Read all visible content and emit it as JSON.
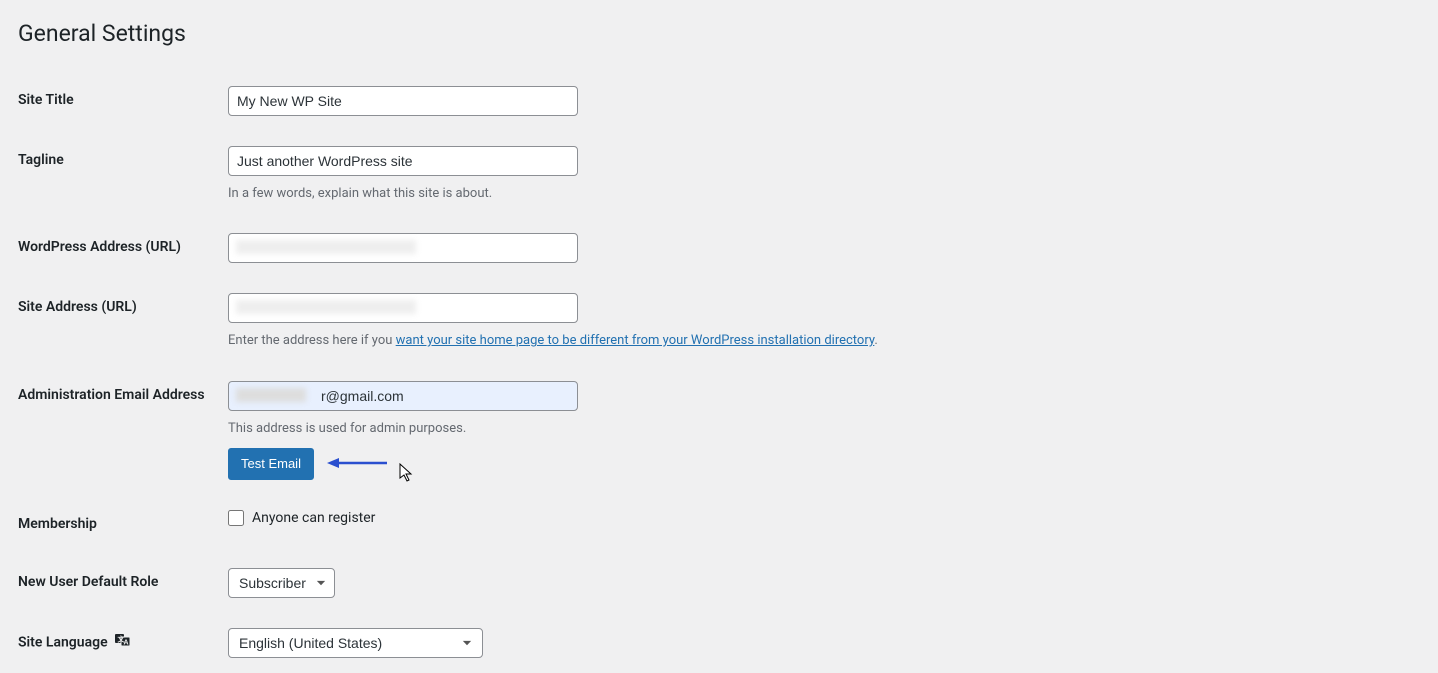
{
  "page": {
    "title": "General Settings"
  },
  "fields": {
    "site_title": {
      "label": "Site Title",
      "value": "My New WP Site"
    },
    "tagline": {
      "label": "Tagline",
      "value": "Just another WordPress site",
      "description": "In a few words, explain what this site is about."
    },
    "wp_address": {
      "label": "WordPress Address (URL)",
      "value": ""
    },
    "site_address": {
      "label": "Site Address (URL)",
      "value": "",
      "desc_prefix": "Enter the address here if you ",
      "desc_link": "want your site home page to be different from your WordPress installation directory",
      "desc_suffix": "."
    },
    "admin_email": {
      "label": "Administration Email Address",
      "value": "r@gmail.com",
      "description": "This address is used for admin purposes.",
      "button_label": "Test Email"
    },
    "membership": {
      "label": "Membership",
      "checkbox_label": "Anyone can register"
    },
    "default_role": {
      "label": "New User Default Role",
      "selected": "Subscriber"
    },
    "site_language": {
      "label": "Site Language",
      "selected": "English (United States)"
    }
  }
}
